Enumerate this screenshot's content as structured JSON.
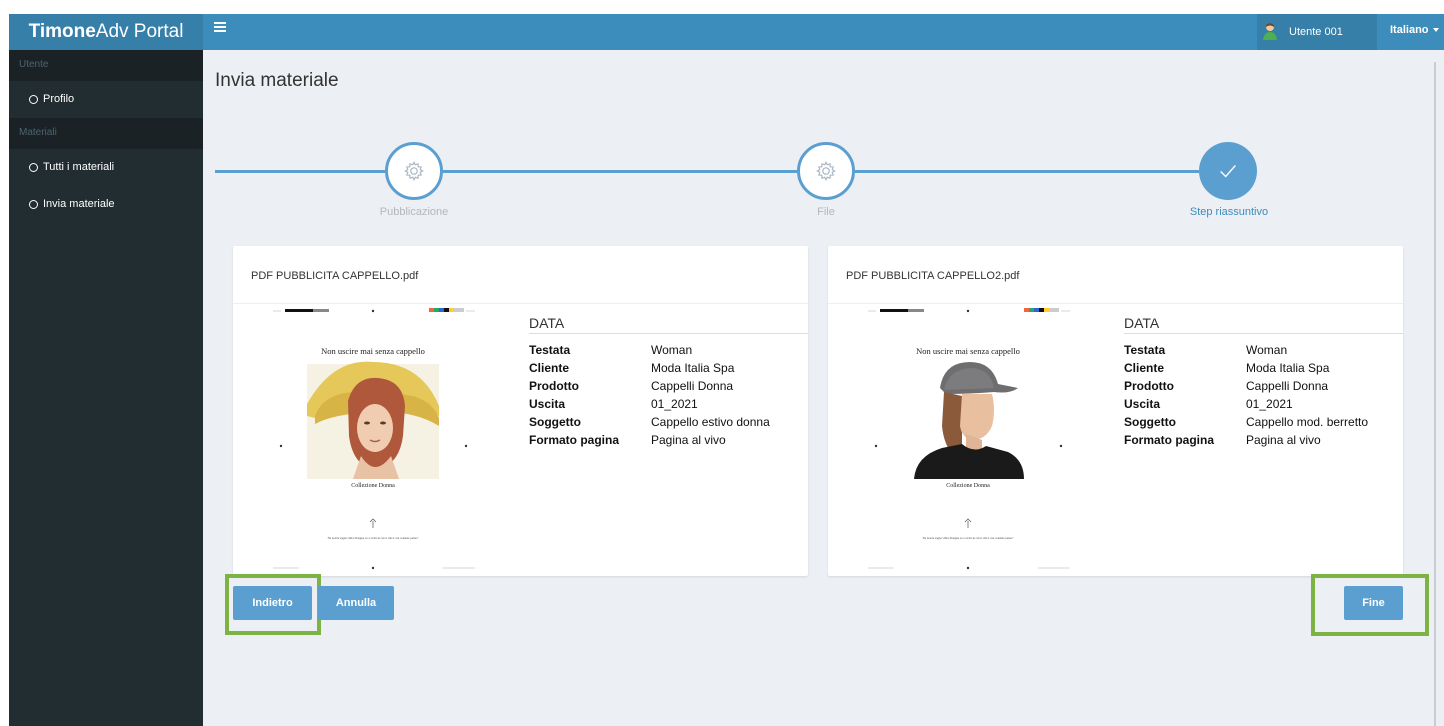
{
  "app": {
    "brand_bold": "Timone",
    "brand_light": "Adv Portal"
  },
  "topbar": {
    "menu_icon": "hamburger-icon",
    "user_name": "Utente 001",
    "language": "Italiano"
  },
  "sidebar": {
    "sections": [
      {
        "header": "Utente",
        "items": [
          {
            "label": "Profilo"
          }
        ]
      },
      {
        "header": "Materiali",
        "items": [
          {
            "label": "Tutti i materiali"
          },
          {
            "label": "Invia materiale"
          }
        ]
      }
    ]
  },
  "page": {
    "title": "Invia materiale"
  },
  "stepper": {
    "steps": [
      {
        "label": "Pubblicazione",
        "state": "pending",
        "icon": "gear-icon"
      },
      {
        "label": "File",
        "state": "pending",
        "icon": "gear-icon"
      },
      {
        "label": "Step riassuntivo",
        "state": "done",
        "icon": "check-icon"
      }
    ],
    "accent": "#5b9fd1"
  },
  "cards": [
    {
      "filename": "PDF PUBBLICITA CAPPELLO.pdf",
      "preview": {
        "headline": "Non uscire mai senza cappello",
        "caption": "Collezione Donna",
        "fine_print": "Ne nostra sagna viltra dlongue ao e ricita in cerca che ti can consiste paino?",
        "image": "woman-straw-hat-photo"
      },
      "data_title": "DATA",
      "fields": [
        {
          "key": "Testata",
          "value": "Woman"
        },
        {
          "key": "Cliente",
          "value": "Moda Italia Spa"
        },
        {
          "key": "Prodotto",
          "value": "Cappelli Donna"
        },
        {
          "key": "Uscita",
          "value": "01_2021"
        },
        {
          "key": "Soggetto",
          "value": "Cappello estivo donna"
        },
        {
          "key": "Formato pagina",
          "value": "Pagina al vivo"
        }
      ]
    },
    {
      "filename": "PDF PUBBLICITA CAPPELLO2.pdf",
      "preview": {
        "headline": "Non uscire mai senza cappello",
        "caption": "Collezione Donna",
        "fine_print": "Ne nostra sagna viltra dlongue ao e ricita in cerca che ti can consiste paino?",
        "image": "woman-grey-cap-photo"
      },
      "data_title": "DATA",
      "fields": [
        {
          "key": "Testata",
          "value": "Woman"
        },
        {
          "key": "Cliente",
          "value": "Moda Italia Spa"
        },
        {
          "key": "Prodotto",
          "value": "Cappelli Donna"
        },
        {
          "key": "Uscita",
          "value": "01_2021"
        },
        {
          "key": "Soggetto",
          "value": "Cappello mod. berretto"
        },
        {
          "key": "Formato pagina",
          "value": "Pagina al vivo"
        }
      ]
    }
  ],
  "buttons": {
    "back": "Indietro",
    "cancel": "Annulla",
    "finish": "Fine"
  },
  "colors": {
    "topbar": "#3c8dbc",
    "sidebar": "#222d32",
    "button": "#5b9fd1",
    "highlight": "#7cb342"
  }
}
